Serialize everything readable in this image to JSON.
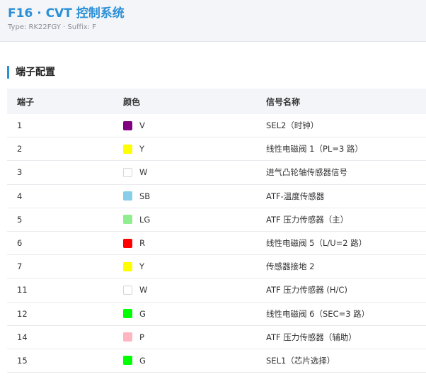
{
  "header": {
    "title": "F16 · CVT 控制系统",
    "subtitle": "Type: RK22FGY · Suffix: F"
  },
  "section": {
    "title": "端子配置"
  },
  "table": {
    "headers": [
      "端子",
      "颜色",
      "信号名称"
    ],
    "rows": [
      {
        "terminal": "1",
        "color_code": "V",
        "swatch": "#800080",
        "signal": "SEL2（时钟）"
      },
      {
        "terminal": "2",
        "color_code": "Y",
        "swatch": "#ffff00",
        "signal": "线性电磁阀 1（PL=3 路）"
      },
      {
        "terminal": "3",
        "color_code": "W",
        "swatch": "#ffffff",
        "signal": "进气凸轮轴传感器信号"
      },
      {
        "terminal": "4",
        "color_code": "SB",
        "swatch": "#87ceeb",
        "signal": "ATF-温度传感器"
      },
      {
        "terminal": "5",
        "color_code": "LG",
        "swatch": "#90ee90",
        "signal": "ATF 压力传感器（主）"
      },
      {
        "terminal": "6",
        "color_code": "R",
        "swatch": "#ff0000",
        "signal": "线性电磁阀 5（L/U=2 路）"
      },
      {
        "terminal": "7",
        "color_code": "Y",
        "swatch": "#ffff00",
        "signal": "传感器接地 2"
      },
      {
        "terminal": "11",
        "color_code": "W",
        "swatch": "#ffffff",
        "signal": "ATF 压力传感器 (H/C)"
      },
      {
        "terminal": "12",
        "color_code": "G",
        "swatch": "#00ff00",
        "signal": "线性电磁阀 6（SEC=3 路）"
      },
      {
        "terminal": "14",
        "color_code": "P",
        "swatch": "#ffb6c1",
        "signal": "ATF 压力传感器（辅助）"
      },
      {
        "terminal": "15",
        "color_code": "G",
        "swatch": "#00ff00",
        "signal": "SEL1（芯片选择）"
      }
    ]
  }
}
